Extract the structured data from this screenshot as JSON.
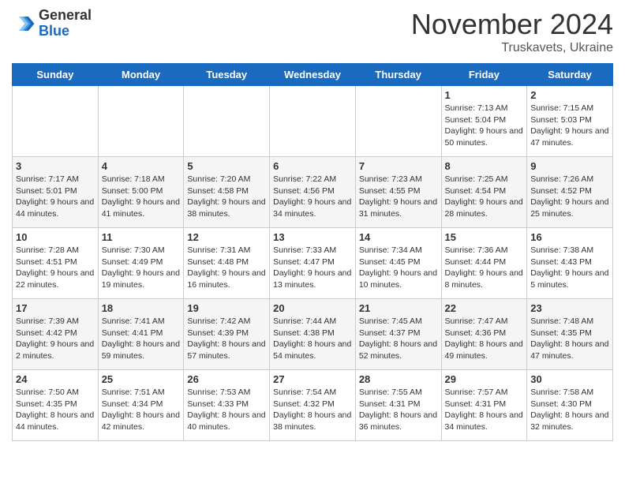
{
  "header": {
    "logo_general": "General",
    "logo_blue": "Blue",
    "title": "November 2024",
    "location": "Truskavets, Ukraine"
  },
  "days_of_week": [
    "Sunday",
    "Monday",
    "Tuesday",
    "Wednesday",
    "Thursday",
    "Friday",
    "Saturday"
  ],
  "weeks": [
    [
      {
        "day": "",
        "info": ""
      },
      {
        "day": "",
        "info": ""
      },
      {
        "day": "",
        "info": ""
      },
      {
        "day": "",
        "info": ""
      },
      {
        "day": "",
        "info": ""
      },
      {
        "day": "1",
        "info": "Sunrise: 7:13 AM\nSunset: 5:04 PM\nDaylight: 9 hours\nand 50 minutes."
      },
      {
        "day": "2",
        "info": "Sunrise: 7:15 AM\nSunset: 5:03 PM\nDaylight: 9 hours\nand 47 minutes."
      }
    ],
    [
      {
        "day": "3",
        "info": "Sunrise: 7:17 AM\nSunset: 5:01 PM\nDaylight: 9 hours\nand 44 minutes."
      },
      {
        "day": "4",
        "info": "Sunrise: 7:18 AM\nSunset: 5:00 PM\nDaylight: 9 hours\nand 41 minutes."
      },
      {
        "day": "5",
        "info": "Sunrise: 7:20 AM\nSunset: 4:58 PM\nDaylight: 9 hours\nand 38 minutes."
      },
      {
        "day": "6",
        "info": "Sunrise: 7:22 AM\nSunset: 4:56 PM\nDaylight: 9 hours\nand 34 minutes."
      },
      {
        "day": "7",
        "info": "Sunrise: 7:23 AM\nSunset: 4:55 PM\nDaylight: 9 hours\nand 31 minutes."
      },
      {
        "day": "8",
        "info": "Sunrise: 7:25 AM\nSunset: 4:54 PM\nDaylight: 9 hours\nand 28 minutes."
      },
      {
        "day": "9",
        "info": "Sunrise: 7:26 AM\nSunset: 4:52 PM\nDaylight: 9 hours\nand 25 minutes."
      }
    ],
    [
      {
        "day": "10",
        "info": "Sunrise: 7:28 AM\nSunset: 4:51 PM\nDaylight: 9 hours\nand 22 minutes."
      },
      {
        "day": "11",
        "info": "Sunrise: 7:30 AM\nSunset: 4:49 PM\nDaylight: 9 hours\nand 19 minutes."
      },
      {
        "day": "12",
        "info": "Sunrise: 7:31 AM\nSunset: 4:48 PM\nDaylight: 9 hours\nand 16 minutes."
      },
      {
        "day": "13",
        "info": "Sunrise: 7:33 AM\nSunset: 4:47 PM\nDaylight: 9 hours\nand 13 minutes."
      },
      {
        "day": "14",
        "info": "Sunrise: 7:34 AM\nSunset: 4:45 PM\nDaylight: 9 hours\nand 10 minutes."
      },
      {
        "day": "15",
        "info": "Sunrise: 7:36 AM\nSunset: 4:44 PM\nDaylight: 9 hours\nand 8 minutes."
      },
      {
        "day": "16",
        "info": "Sunrise: 7:38 AM\nSunset: 4:43 PM\nDaylight: 9 hours\nand 5 minutes."
      }
    ],
    [
      {
        "day": "17",
        "info": "Sunrise: 7:39 AM\nSunset: 4:42 PM\nDaylight: 9 hours\nand 2 minutes."
      },
      {
        "day": "18",
        "info": "Sunrise: 7:41 AM\nSunset: 4:41 PM\nDaylight: 8 hours\nand 59 minutes."
      },
      {
        "day": "19",
        "info": "Sunrise: 7:42 AM\nSunset: 4:39 PM\nDaylight: 8 hours\nand 57 minutes."
      },
      {
        "day": "20",
        "info": "Sunrise: 7:44 AM\nSunset: 4:38 PM\nDaylight: 8 hours\nand 54 minutes."
      },
      {
        "day": "21",
        "info": "Sunrise: 7:45 AM\nSunset: 4:37 PM\nDaylight: 8 hours\nand 52 minutes."
      },
      {
        "day": "22",
        "info": "Sunrise: 7:47 AM\nSunset: 4:36 PM\nDaylight: 8 hours\nand 49 minutes."
      },
      {
        "day": "23",
        "info": "Sunrise: 7:48 AM\nSunset: 4:35 PM\nDaylight: 8 hours\nand 47 minutes."
      }
    ],
    [
      {
        "day": "24",
        "info": "Sunrise: 7:50 AM\nSunset: 4:35 PM\nDaylight: 8 hours\nand 44 minutes."
      },
      {
        "day": "25",
        "info": "Sunrise: 7:51 AM\nSunset: 4:34 PM\nDaylight: 8 hours\nand 42 minutes."
      },
      {
        "day": "26",
        "info": "Sunrise: 7:53 AM\nSunset: 4:33 PM\nDaylight: 8 hours\nand 40 minutes."
      },
      {
        "day": "27",
        "info": "Sunrise: 7:54 AM\nSunset: 4:32 PM\nDaylight: 8 hours\nand 38 minutes."
      },
      {
        "day": "28",
        "info": "Sunrise: 7:55 AM\nSunset: 4:31 PM\nDaylight: 8 hours\nand 36 minutes."
      },
      {
        "day": "29",
        "info": "Sunrise: 7:57 AM\nSunset: 4:31 PM\nDaylight: 8 hours\nand 34 minutes."
      },
      {
        "day": "30",
        "info": "Sunrise: 7:58 AM\nSunset: 4:30 PM\nDaylight: 8 hours\nand 32 minutes."
      }
    ]
  ]
}
